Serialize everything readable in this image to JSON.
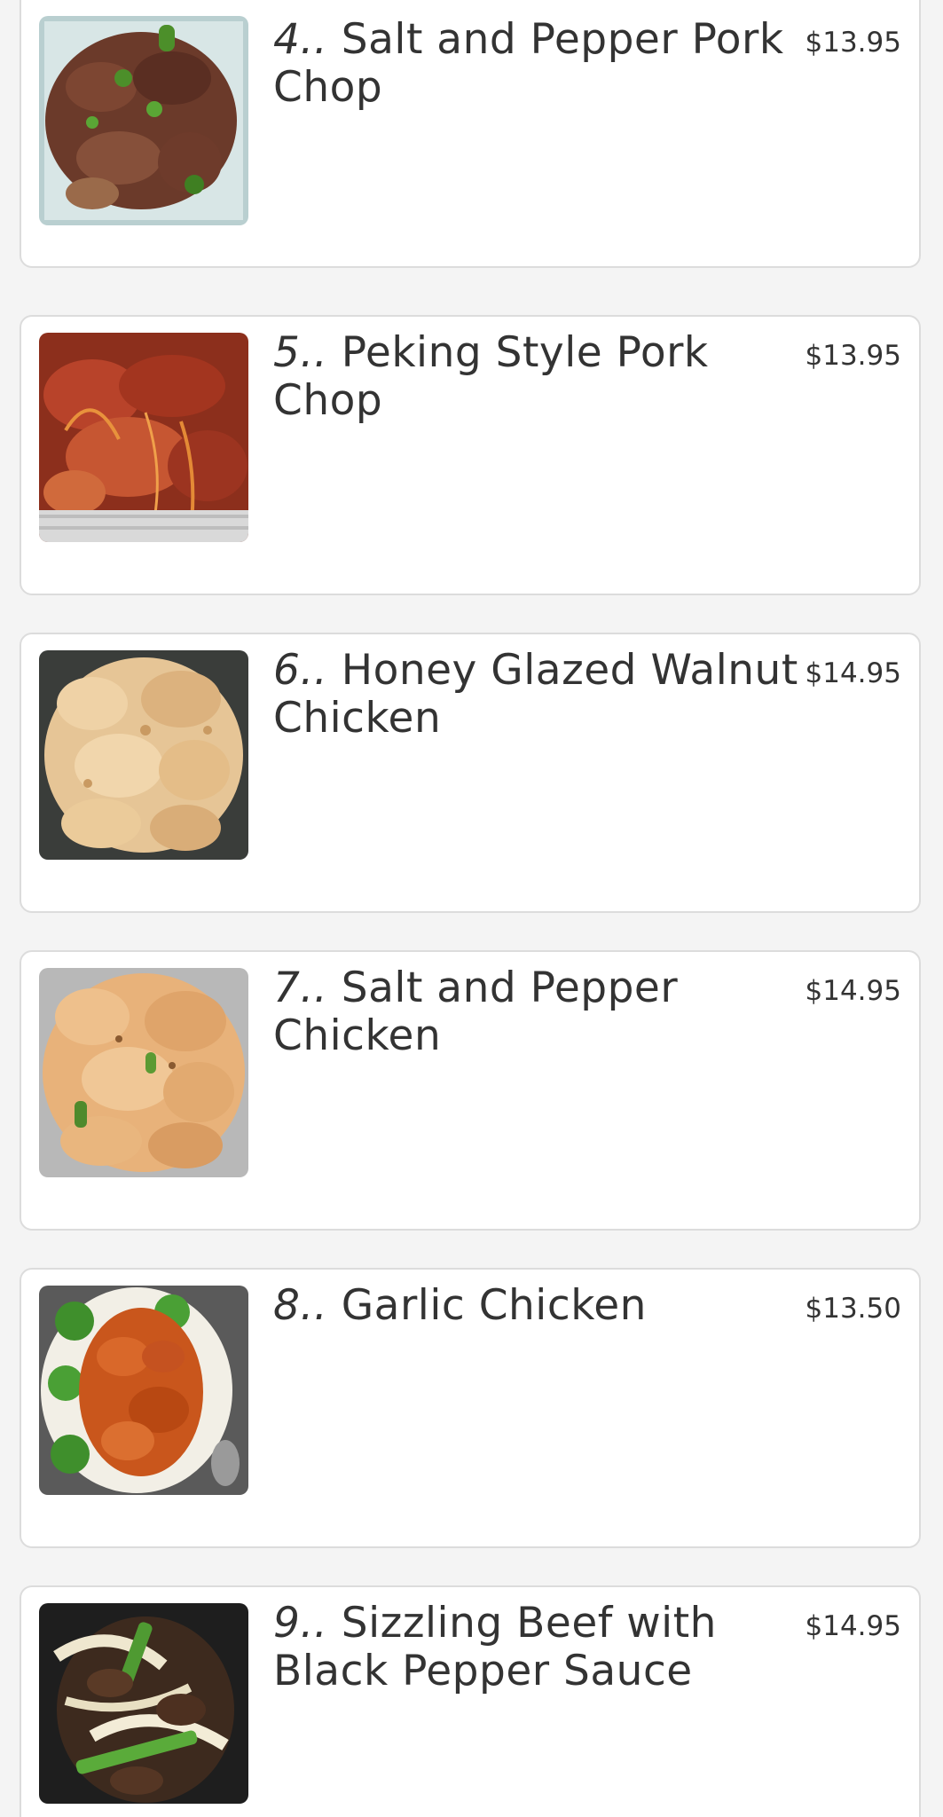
{
  "menu": {
    "items": [
      {
        "number": "4..",
        "name": "Salt and Pepper Pork Chop",
        "price": "$13.95",
        "photo": "salt-pepper-pork-chop-photo"
      },
      {
        "number": "5..",
        "name": "Peking Style Pork Chop",
        "price": "$13.95",
        "photo": "peking-pork-chop-photo"
      },
      {
        "number": "6..",
        "name": "Honey Glazed Walnut Chicken",
        "price": "$14.95",
        "photo": "walnut-chicken-photo"
      },
      {
        "number": "7..",
        "name": "Salt and Pepper Chicken",
        "price": "$14.95",
        "photo": "salt-pepper-chicken-photo"
      },
      {
        "number": "8..",
        "name": "Garlic Chicken",
        "price": "$13.50",
        "photo": "garlic-chicken-photo"
      },
      {
        "number": "9..",
        "name": "Sizzling Beef with Black Pepper Sauce",
        "price": "$14.95",
        "photo": "sizzling-beef-photo"
      }
    ]
  },
  "colors": {
    "page_background": "#f4f4f4",
    "card_background": "#ffffff",
    "card_border": "#dcdcdc",
    "text": "#333333"
  }
}
